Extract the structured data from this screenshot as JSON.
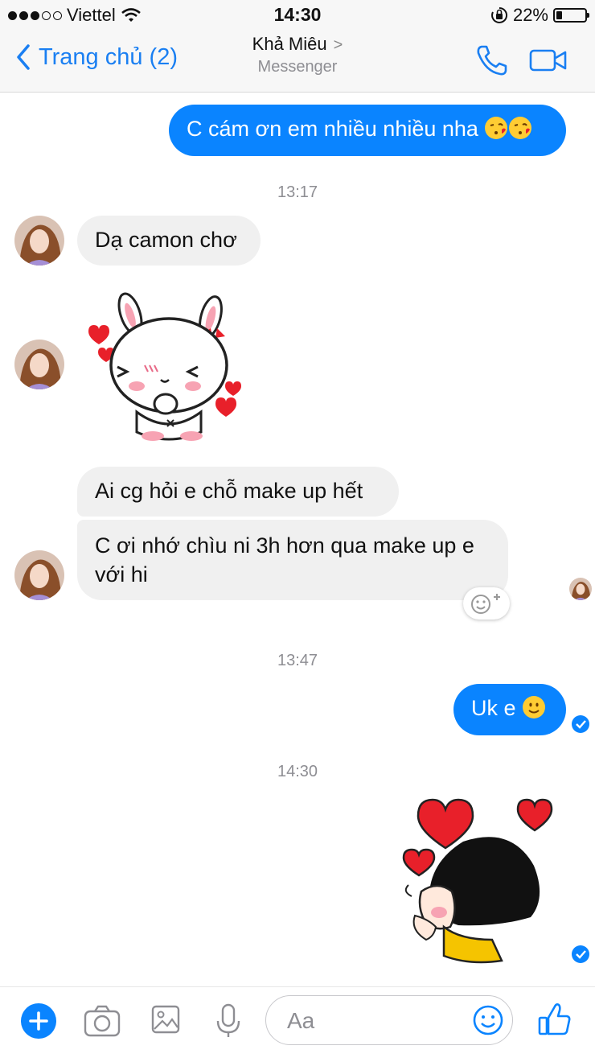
{
  "status_bar": {
    "carrier": "Viettel",
    "time": "14:30",
    "battery": "22%",
    "battery_level": 0.22
  },
  "header": {
    "back_label": "Trang chủ (2)",
    "contact_name": "Khả Miêu",
    "subtitle": "Messenger"
  },
  "messages": {
    "out_1": "C cám ơn em nhiều nhiều nha",
    "ts_1": "13:17",
    "in_1": "Dạ camon chơ",
    "in_2": "Ai cg hỏi e chỗ make up hết",
    "in_3": "C ơi nhớ chìu ni 3h hơn qua make up e với hi",
    "ts_2": "13:47",
    "out_2": "Uk e",
    "ts_3": "14:30"
  },
  "composer": {
    "placeholder": "Aa"
  },
  "colors": {
    "accent": "#0a84ff",
    "incoming": "#f0f0f0",
    "timestamp": "#8e8e93"
  },
  "icons": [
    "back-chevron-icon",
    "phone-icon",
    "video-camera-icon",
    "plus-icon",
    "camera-icon",
    "image-icon",
    "microphone-icon",
    "emoji-icon",
    "like-thumb-icon",
    "read-receipt-icon"
  ]
}
